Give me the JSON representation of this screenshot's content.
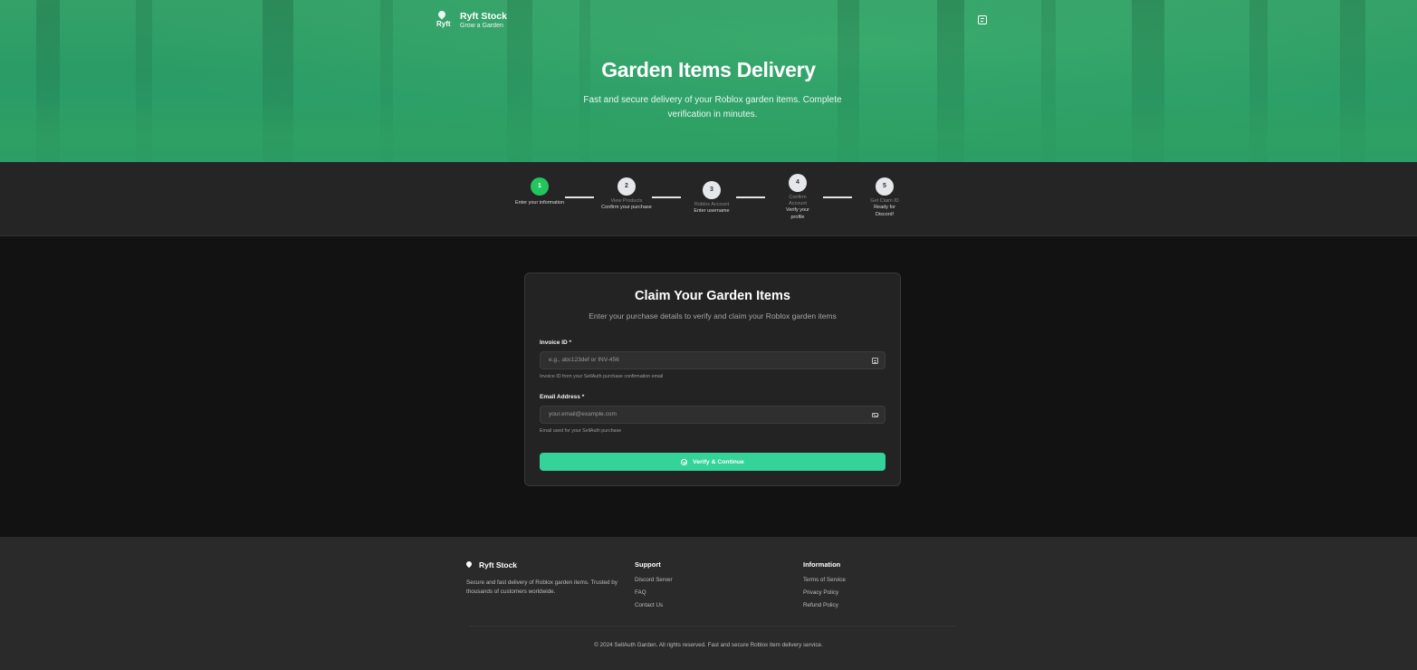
{
  "header": {
    "brand_logo_text": "Ryft",
    "brand_name": "Ryft Stock",
    "brand_tagline": "Grow a Garden",
    "chat_icon": "chat-icon"
  },
  "hero": {
    "title": "Garden Items Delivery",
    "subtitle": "Fast and secure delivery of your Roblox garden items. Complete verification in minutes."
  },
  "steps": [
    {
      "number": "1",
      "title": "",
      "desc": "Enter your information",
      "active": true
    },
    {
      "number": "2",
      "title": "View Products",
      "desc": "Confirm your purchase",
      "active": false
    },
    {
      "number": "3",
      "title": "Roblox Account",
      "desc": "Enter username",
      "active": false
    },
    {
      "number": "4",
      "title": "Confirm Account",
      "desc": "Verify your profile",
      "active": false
    },
    {
      "number": "5",
      "title": "Get Claim ID",
      "desc": "Ready for Discord!",
      "active": false
    }
  ],
  "form": {
    "title": "Claim Your Garden Items",
    "subtitle": "Enter your purchase details to verify and claim your Roblox garden items",
    "invoice": {
      "label": "Invoice ID *",
      "placeholder": "e.g., abc123def or INV-456",
      "help": "Invoice ID from your SellAuth purchase confirmation email",
      "icon": "document-icon"
    },
    "email": {
      "label": "Email Address *",
      "placeholder": "your.email@example.com",
      "help": "Email used for your SellAuth purchase",
      "icon": "mail-icon"
    },
    "submit_label": "Verify & Continue",
    "accent_color": "#34d399"
  },
  "footer": {
    "brand_name": "Ryft Stock",
    "description": "Secure and fast delivery of Roblox garden items. Trusted by thousands of customers worldwide.",
    "support": {
      "heading": "Support",
      "links": [
        "Discord Server",
        "FAQ",
        "Contact Us"
      ]
    },
    "information": {
      "heading": "Information",
      "links": [
        "Terms of Service",
        "Privacy Policy",
        "Refund Policy"
      ]
    },
    "copyright": "© 2024 SellAuth Garden. All rights reserved. Fast and secure Roblox item delivery service."
  }
}
